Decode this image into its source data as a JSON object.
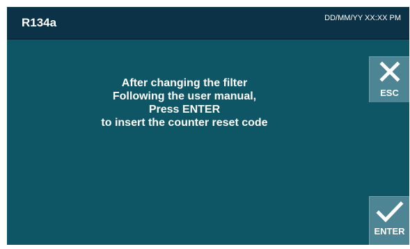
{
  "header": {
    "title": "R134a",
    "datetime": "DD/MM/YY XX:XX PM"
  },
  "message": {
    "lines": [
      "After changing the filter",
      "Following the user manual,",
      "Press ENTER",
      "to insert the counter reset code"
    ]
  },
  "buttons": {
    "esc": {
      "label": "ESC",
      "icon": "close-icon"
    },
    "enter": {
      "label": "ENTER",
      "icon": "checkmark-icon"
    }
  },
  "colors": {
    "background": "#0e5566",
    "header": "#0c3247",
    "button": "#4d8595",
    "text": "#ffffff"
  }
}
